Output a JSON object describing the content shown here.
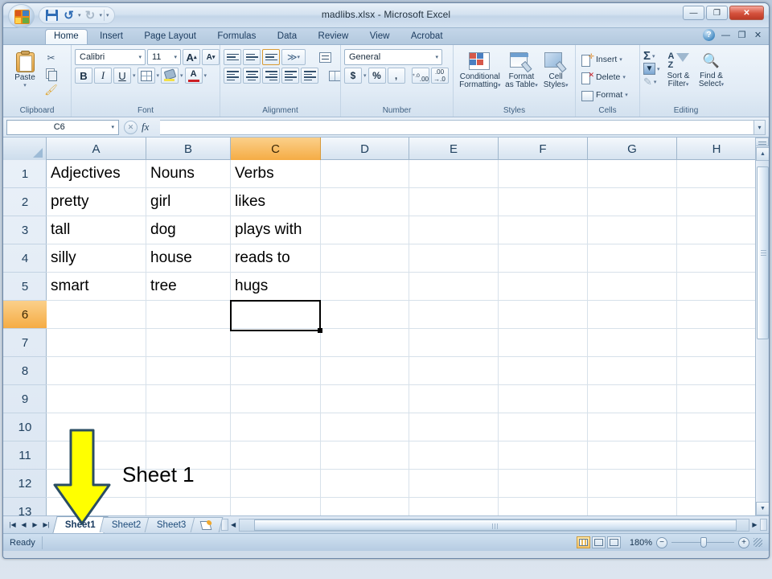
{
  "window": {
    "title": "madlibs.xlsx - Microsoft Excel",
    "office_button": "Office",
    "minimize": "—",
    "maximize": "❐",
    "close": "✕",
    "ribbon_minimize": "—",
    "ribbon_restore": "❐",
    "ribbon_close": "✕",
    "help": "?"
  },
  "quick_access": {
    "save": "Save",
    "undo": "↺",
    "redo": "↻",
    "customize": "▾"
  },
  "tabs": [
    {
      "label": "Home",
      "active": true
    },
    {
      "label": "Insert",
      "active": false
    },
    {
      "label": "Page Layout",
      "active": false
    },
    {
      "label": "Formulas",
      "active": false
    },
    {
      "label": "Data",
      "active": false
    },
    {
      "label": "Review",
      "active": false
    },
    {
      "label": "View",
      "active": false
    },
    {
      "label": "Acrobat",
      "active": false
    }
  ],
  "ribbon": {
    "clipboard": {
      "title": "Clipboard",
      "paste": "Paste",
      "paste_caret": "▾",
      "cut": "✂",
      "copy": "Copy",
      "format_painter": "Format Painter",
      "dialog_launcher": "◹"
    },
    "font": {
      "title": "Font",
      "font_name": "Calibri",
      "font_size": "11",
      "grow_font": "A",
      "shrink_font": "A",
      "bold": "B",
      "italic": "I",
      "underline": "U",
      "caret": "▾",
      "borders": "Borders",
      "fill_color": "Fill Color",
      "font_color": "A",
      "dialog_launcher": "◹"
    },
    "alignment": {
      "title": "Alignment",
      "top_align": "Top Align",
      "middle_align": "Middle Align",
      "bottom_align": "Bottom Align",
      "orientation": "≫",
      "align_left": "Align Text Left",
      "align_center": "Center",
      "align_right": "Align Text Right",
      "decrease_indent": "Decrease Indent",
      "increase_indent": "Increase Indent",
      "wrap_text": "Wrap Text",
      "merge_center": "Merge & Center",
      "caret": "▾",
      "dialog_launcher": "◹"
    },
    "number": {
      "title": "Number",
      "format": "General",
      "caret": "▾",
      "currency": "$",
      "percent": "%",
      "comma": ",",
      "increase_decimal": ".00",
      "decrease_decimal": ".0",
      "dialog_launcher": "◹"
    },
    "styles": {
      "title": "Styles",
      "conditional_formatting": "Conditional\nFormatting",
      "conditional_formatting_l1": "Conditional",
      "conditional_formatting_l2": "Formatting",
      "format_as_table_l1": "Format",
      "format_as_table_l2": "as Table",
      "cell_styles_l1": "Cell",
      "cell_styles_l2": "Styles",
      "caret": "▾"
    },
    "cells": {
      "title": "Cells",
      "insert": "Insert",
      "delete": "Delete",
      "format": "Format",
      "caret": "▾"
    },
    "editing": {
      "title": "Editing",
      "autosum": "Σ",
      "fill": "▼",
      "clear": "✎",
      "sort_filter_l1": "Sort &",
      "sort_filter_l2": "Filter",
      "find_select_l1": "Find &",
      "find_select_l2": "Select",
      "caret": "▾"
    }
  },
  "formula_bar": {
    "name_box": "C6",
    "name_box_caret": "▾",
    "cancel": "✕",
    "enter": "✓",
    "insert_function": "fx",
    "value": "",
    "expand": "▾"
  },
  "grid": {
    "columns": [
      "A",
      "B",
      "C",
      "D",
      "E",
      "F",
      "G",
      "H"
    ],
    "selected_column": "C",
    "rows": [
      "1",
      "2",
      "3",
      "4",
      "5",
      "6",
      "7",
      "8",
      "9",
      "10",
      "11",
      "12",
      "13"
    ],
    "selected_row": "6",
    "selected_cell": "C6",
    "data": [
      {
        "row": "1",
        "A": "Adjectives",
        "B": "Nouns",
        "C": "Verbs"
      },
      {
        "row": "2",
        "A": "pretty",
        "B": "girl",
        "C": "likes"
      },
      {
        "row": "3",
        "A": "tall",
        "B": "dog",
        "C": "plays with"
      },
      {
        "row": "4",
        "A": "silly",
        "B": "house",
        "C": "reads to"
      },
      {
        "row": "5",
        "A": "smart",
        "B": "tree",
        "C": "hugs"
      }
    ]
  },
  "sheet_tabs": {
    "first": "|◀",
    "prev": "◀",
    "next": "▶",
    "last": "▶|",
    "sheets": [
      {
        "label": "Sheet1",
        "active": true
      },
      {
        "label": "Sheet2",
        "active": false
      },
      {
        "label": "Sheet3",
        "active": false
      }
    ],
    "insert_sheet": "Insert Worksheet"
  },
  "status_bar": {
    "status": "Ready",
    "normal_view": "Normal",
    "page_layout_view": "Page Layout",
    "page_break_view": "Page Break Preview",
    "zoom_level": "180%",
    "zoom_out": "−",
    "zoom_in": "+",
    "resize_grip": "grip"
  },
  "annotation": {
    "label": "Sheet 1",
    "arrow_color": "#ffff00",
    "arrow_outline": "#2a4d63"
  },
  "colors": {
    "selected_header": "#f5ac45",
    "selection_border": "#000000",
    "title_text": "#23323f"
  }
}
